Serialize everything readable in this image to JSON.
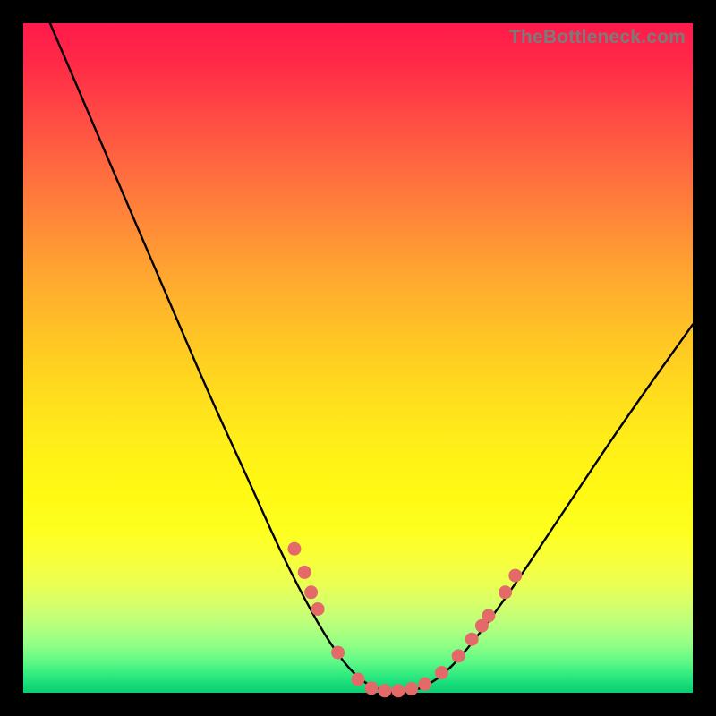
{
  "watermark": "TheBottleneck.com",
  "colors": {
    "frame": "#000000",
    "curve_stroke": "#000000",
    "dot_fill": "#e46a6a",
    "dot_stroke": "#d85a5a"
  },
  "chart_data": {
    "type": "line",
    "title": "",
    "xlabel": "",
    "ylabel": "",
    "xlim": [
      0,
      100
    ],
    "ylim": [
      0,
      100
    ],
    "grid": false,
    "legend": false,
    "series": [
      {
        "name": "bottleneck-curve",
        "x": [
          4,
          10,
          16,
          22,
          28,
          34,
          38,
          42,
          46,
          50,
          54,
          58,
          62,
          66,
          72,
          80,
          90,
          100
        ],
        "y": [
          100,
          86,
          72,
          58,
          44,
          31,
          22,
          14,
          7,
          2,
          0,
          0,
          2,
          6,
          14,
          26,
          41,
          55
        ]
      }
    ],
    "markers": [
      {
        "x": 40.5,
        "y": 21.5
      },
      {
        "x": 42.0,
        "y": 18.0
      },
      {
        "x": 43.0,
        "y": 15.0
      },
      {
        "x": 44.0,
        "y": 12.5
      },
      {
        "x": 47.0,
        "y": 6.0
      },
      {
        "x": 50.0,
        "y": 2.0
      },
      {
        "x": 52.0,
        "y": 0.7
      },
      {
        "x": 54.0,
        "y": 0.3
      },
      {
        "x": 56.0,
        "y": 0.3
      },
      {
        "x": 58.0,
        "y": 0.6
      },
      {
        "x": 60.0,
        "y": 1.3
      },
      {
        "x": 62.5,
        "y": 3.0
      },
      {
        "x": 65.0,
        "y": 5.5
      },
      {
        "x": 67.0,
        "y": 8.0
      },
      {
        "x": 68.5,
        "y": 10.0
      },
      {
        "x": 69.5,
        "y": 11.5
      },
      {
        "x": 72.0,
        "y": 15.0
      },
      {
        "x": 73.5,
        "y": 17.5
      }
    ]
  }
}
